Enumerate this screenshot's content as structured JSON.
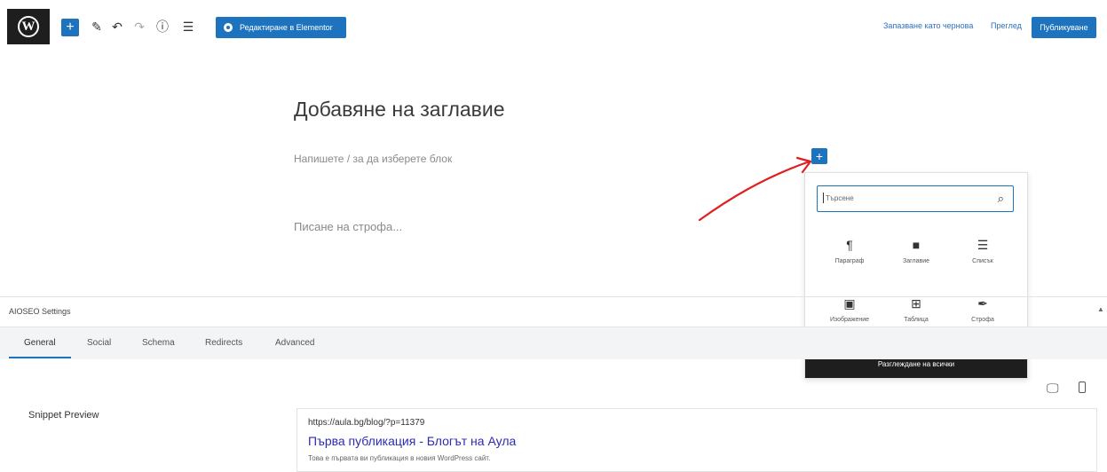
{
  "toolbar": {
    "logo": "W",
    "add_block": "+",
    "icons": [
      "pencil-icon",
      "undo-icon",
      "redo-icon",
      "info-icon",
      "list-view-icon"
    ],
    "elementor_label": "Редактиране в Elementor",
    "save_draft_label": "Запазване като чернова",
    "preview_label": "Преглед",
    "publish_label": "Публикуване"
  },
  "editor": {
    "title_placeholder": "Добавяне на заглавие",
    "block_placeholder": "Напишете / за да изберете блок",
    "verse_placeholder": "Писане на строфа...",
    "inserter_toggle": "+"
  },
  "inserter": {
    "search_placeholder": "Търсене",
    "blocks": [
      {
        "label": "Параграф",
        "icon": "paragraph-icon",
        "glyph": "¶"
      },
      {
        "label": "Заглавие",
        "icon": "heading-icon",
        "glyph": "■"
      },
      {
        "label": "Списък",
        "icon": "list-icon",
        "glyph": "☰"
      },
      {
        "label": "Изображение",
        "icon": "image-icon",
        "glyph": "▣"
      },
      {
        "label": "Таблица",
        "icon": "table-icon",
        "glyph": "⊞"
      },
      {
        "label": "Строфа",
        "icon": "verse-icon",
        "glyph": "✒"
      }
    ],
    "browse_all_label": "Разглеждане на всички"
  },
  "aioseo": {
    "title": "AIOSEO Settings",
    "collapse": "▲",
    "tabs": [
      "General",
      "Social",
      "Schema",
      "Redirects",
      "Advanced"
    ],
    "active_tab": "General",
    "snippet_label": "Snippet Preview",
    "snippet": {
      "url": "https://aula.bg/blog/?p=11379",
      "title": "Първа публикация - Блогът на Аула",
      "description": "Това е първата ви публикация в новия WordPress сайт."
    }
  },
  "colors": {
    "accent": "#1e73be",
    "dark": "#1e1e1e",
    "annotation_arrow": "#e02020",
    "link": "#2c2bb3"
  }
}
